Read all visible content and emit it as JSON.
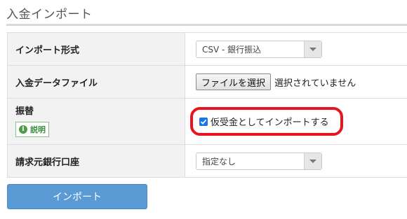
{
  "page": {
    "title": "入金インポート"
  },
  "form": {
    "import_format": {
      "label": "インポート形式",
      "selected": "CSV - 銀行振込"
    },
    "deposit_file": {
      "label": "入金データファイル",
      "button_label": "ファイルを選択",
      "status": "選択されていません"
    },
    "transfer": {
      "label": "振替",
      "help_label": "説明",
      "help_icon": "i",
      "checkbox_label": "仮受金としてインポートする",
      "checked": true
    },
    "billing_bank": {
      "label": "請求元銀行口座",
      "selected": "指定なし"
    }
  },
  "actions": {
    "import_label": "インポート"
  },
  "colors": {
    "highlight": "#e8141e",
    "primary_button": "#5b9bd5",
    "help_green": "#3d8b3d"
  }
}
